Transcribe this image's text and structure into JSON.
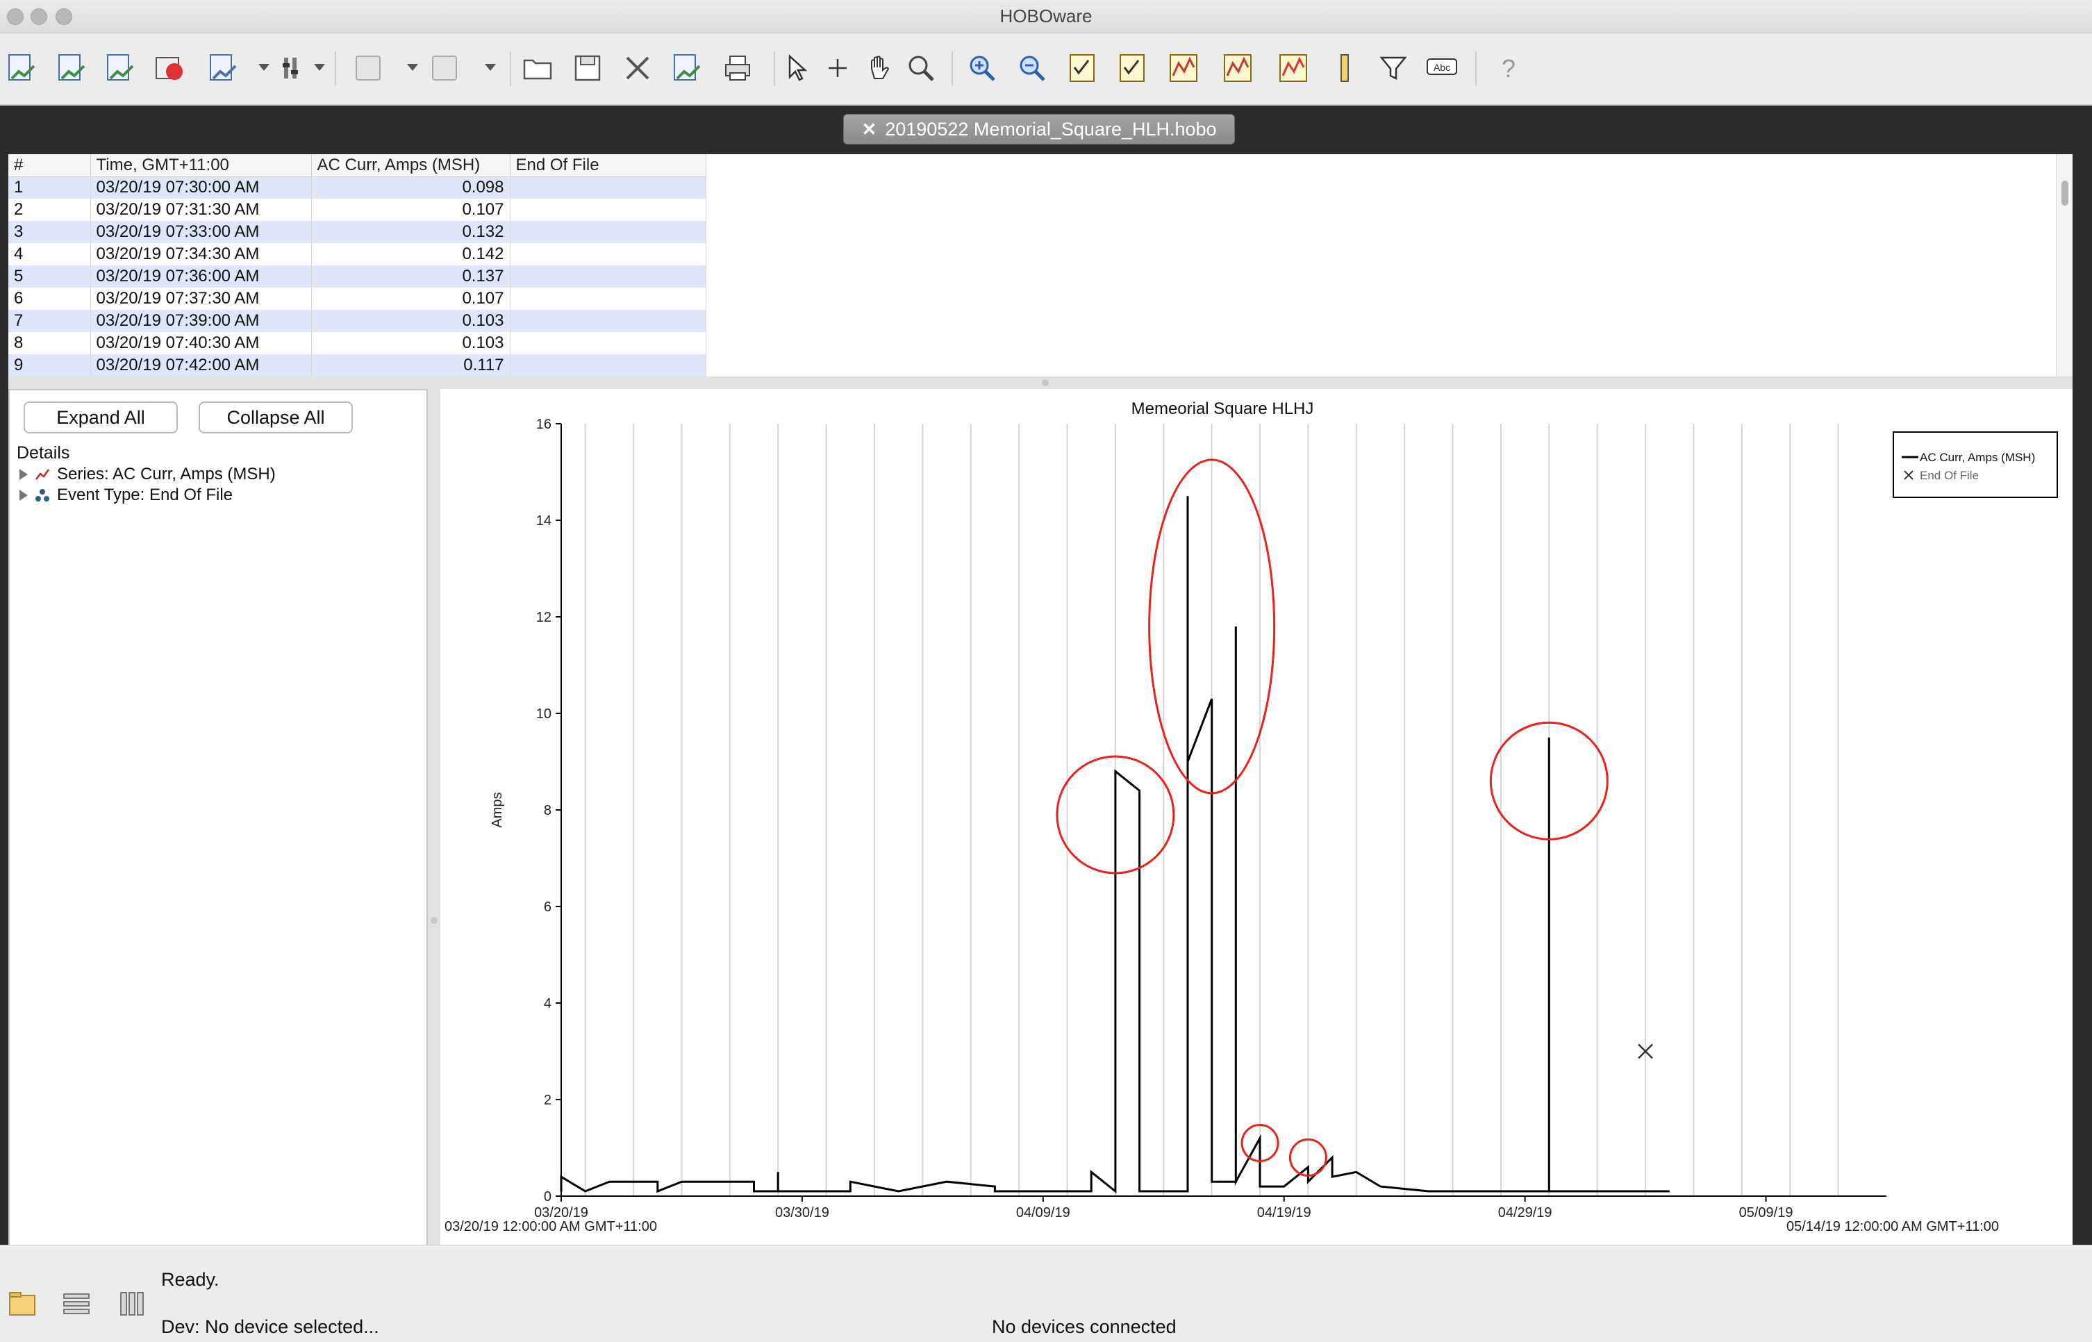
{
  "window": {
    "title": "HOBOware"
  },
  "toolbar": {
    "buttons": [
      "readout-icon",
      "launch-icon",
      "status-icon",
      "stop-icon",
      "pages-icon",
      "settings-icon",
      "undo-icon",
      "redo-icon",
      "open-folder-icon",
      "save-icon",
      "close-file-icon",
      "export-icon",
      "print-icon",
      "pointer-icon",
      "crosshair-icon",
      "hand-icon",
      "magnifier-icon",
      "zoom-in-icon",
      "zoom-out-icon",
      "graph-setup-icon",
      "checklist-icon",
      "plot-icon",
      "overlay-icon",
      "series-icon",
      "ruler-icon",
      "filter-icon",
      "label-icon",
      "help-icon"
    ]
  },
  "document_tab": {
    "close_glyph": "✕",
    "label": "20190522 Memorial_Square_HLH.hobo"
  },
  "table": {
    "columns": [
      "#",
      "Time, GMT+11:00",
      "AC Curr, Amps (MSH)",
      "End Of File"
    ],
    "rows": [
      [
        "1",
        "03/20/19 07:30:00 AM",
        "0.098",
        ""
      ],
      [
        "2",
        "03/20/19 07:31:30 AM",
        "0.107",
        ""
      ],
      [
        "3",
        "03/20/19 07:33:00 AM",
        "0.132",
        ""
      ],
      [
        "4",
        "03/20/19 07:34:30 AM",
        "0.142",
        ""
      ],
      [
        "5",
        "03/20/19 07:36:00 AM",
        "0.137",
        ""
      ],
      [
        "6",
        "03/20/19 07:37:30 AM",
        "0.107",
        ""
      ],
      [
        "7",
        "03/20/19 07:39:00 AM",
        "0.103",
        ""
      ],
      [
        "8",
        "03/20/19 07:40:30 AM",
        "0.103",
        ""
      ],
      [
        "9",
        "03/20/19 07:42:00 AM",
        "0.117",
        ""
      ]
    ]
  },
  "details": {
    "expand_all": "Expand All",
    "collapse_all": "Collapse All",
    "title": "Details",
    "items": [
      "Series: AC Curr, Amps (MSH)",
      "Event Type: End Of File"
    ]
  },
  "chart_data": {
    "type": "line",
    "title": "Memeorial Square HLHJ",
    "ylabel": "Amps",
    "xlabel": "",
    "ylim": [
      0,
      16
    ],
    "yticks": [
      0,
      2,
      4,
      6,
      8,
      10,
      12,
      14,
      16
    ],
    "xlim": [
      "03/20/19",
      "05/14/19"
    ],
    "xticks": [
      "03/20/19",
      "03/30/19",
      "04/09/19",
      "04/19/19",
      "04/29/19",
      "05/09/19"
    ],
    "x_start_label": "03/20/19 12:00:00 AM GMT+11:00",
    "x_end_label": "05/14/19 12:00:00 AM GMT+11:00",
    "grid": "vertical",
    "legend": {
      "placement": "top-right",
      "entries": [
        "AC Curr, Amps (MSH)",
        "End Of File"
      ]
    },
    "series": [
      {
        "name": "AC Curr, Amps (MSH)",
        "color": "#000000",
        "points": [
          [
            "03/20/19",
            0.1
          ],
          [
            "03/20/19",
            0.4
          ],
          [
            "03/21/19",
            0.1
          ],
          [
            "03/22/19",
            0.3
          ],
          [
            "03/24/19",
            0.3
          ],
          [
            "03/24/19",
            0.1
          ],
          [
            "03/25/19",
            0.3
          ],
          [
            "03/28/19",
            0.3
          ],
          [
            "03/28/19",
            0.1
          ],
          [
            "03/29/19",
            0.1
          ],
          [
            "03/29/19",
            0.5
          ],
          [
            "03/29/19",
            0.1
          ],
          [
            "04/01/19",
            0.1
          ],
          [
            "04/01/19",
            0.3
          ],
          [
            "04/02/19",
            0.2
          ],
          [
            "04/03/19",
            0.1
          ],
          [
            "04/05/19",
            0.3
          ],
          [
            "04/07/19",
            0.2
          ],
          [
            "04/07/19",
            0.1
          ],
          [
            "04/10/19",
            0.1
          ],
          [
            "04/11/19",
            0.1
          ],
          [
            "04/11/19",
            0.5
          ],
          [
            "04/12/19",
            0.1
          ],
          [
            "04/12/19",
            7.2
          ],
          [
            "04/12/19",
            8.8
          ],
          [
            "04/13/19",
            8.4
          ],
          [
            "04/13/19",
            0.1
          ],
          [
            "04/15/19",
            0.1
          ],
          [
            "04/15/19",
            0.6
          ],
          [
            "04/15/19",
            14.5
          ],
          [
            "04/15/19",
            9.0
          ],
          [
            "04/16/19",
            10.3
          ],
          [
            "04/16/19",
            8.0
          ],
          [
            "04/16/19",
            0.3
          ],
          [
            "04/17/19",
            0.3
          ],
          [
            "04/17/19",
            11.8
          ],
          [
            "04/17/19",
            8.6
          ],
          [
            "04/17/19",
            0.3
          ],
          [
            "04/18/19",
            1.2
          ],
          [
            "04/18/19",
            0.2
          ],
          [
            "04/19/19",
            0.2
          ],
          [
            "04/20/19",
            0.6
          ],
          [
            "04/20/19",
            0.3
          ],
          [
            "04/21/19",
            0.8
          ],
          [
            "04/21/19",
            0.4
          ],
          [
            "04/22/19",
            0.5
          ],
          [
            "04/23/19",
            0.2
          ],
          [
            "04/25/19",
            0.1
          ],
          [
            "04/28/19",
            0.1
          ],
          [
            "04/30/19",
            0.1
          ],
          [
            "04/30/19",
            9.5
          ],
          [
            "04/30/19",
            9.3
          ],
          [
            "04/30/19",
            0.1
          ],
          [
            "05/02/19",
            0.1
          ],
          [
            "05/05/19",
            0.1
          ]
        ]
      },
      {
        "name": "End Of File",
        "marker": "x",
        "points": [
          [
            "05/04/19",
            3.0
          ]
        ]
      }
    ],
    "annotations": [
      {
        "shape": "circle",
        "color": "#e8241a",
        "center": [
          "04/12/19",
          7.9
        ]
      },
      {
        "shape": "ellipse",
        "color": "#e8241a",
        "center": [
          "04/16/19",
          11.8
        ]
      },
      {
        "shape": "circle",
        "color": "#e8241a",
        "center": [
          "04/18/19",
          1.1
        ]
      },
      {
        "shape": "circle",
        "color": "#e8241a",
        "center": [
          "04/20/19",
          0.8
        ]
      },
      {
        "shape": "circle",
        "color": "#e8241a",
        "center": [
          "04/30/19",
          8.6
        ]
      }
    ]
  },
  "status": {
    "ready": "Ready.",
    "device": "Dev: No device selected...",
    "connection": "No devices connected"
  }
}
